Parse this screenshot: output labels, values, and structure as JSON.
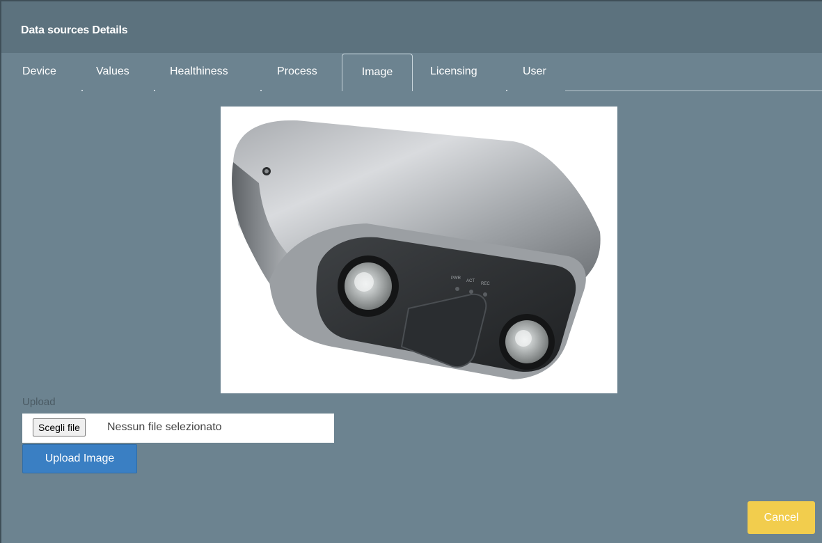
{
  "dialog": {
    "title": "Data sources Details"
  },
  "tabs": [
    {
      "label": "Device"
    },
    {
      "label": "Values"
    },
    {
      "label": "Healthiness"
    },
    {
      "label": "Process"
    },
    {
      "label": "Image",
      "active": true
    },
    {
      "label": "Licensing"
    },
    {
      "label": "User"
    }
  ],
  "image_tab": {
    "image_subject": "stereo-dome-camera",
    "upload_label": "Upload",
    "file_button_label": "Scegli file",
    "file_status": "Nessun file selezionato",
    "upload_button_label": "Upload Image",
    "camera_led_labels": [
      "PWR",
      "ACT",
      "REC"
    ]
  },
  "footer": {
    "cancel_label": "Cancel"
  },
  "colors": {
    "background": "#6c8390",
    "header": "#5c727e",
    "primary_button": "#3a7fc3",
    "cancel_button": "#f2cd4d"
  }
}
